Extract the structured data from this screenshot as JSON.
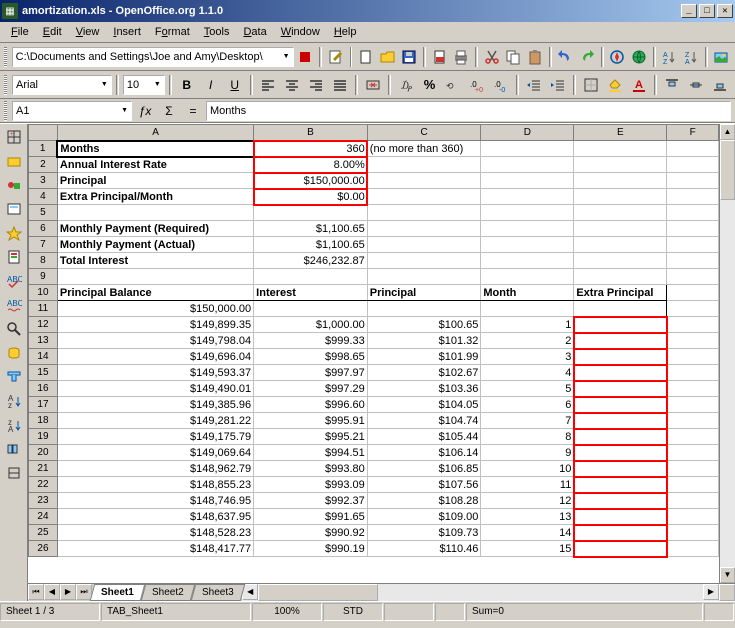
{
  "title": "amortization.xls - OpenOffice.org 1.1.0",
  "menu": [
    "File",
    "Edit",
    "View",
    "Insert",
    "Format",
    "Tools",
    "Data",
    "Window",
    "Help"
  ],
  "path": "C:\\Documents and Settings\\Joe and Amy\\Desktop\\",
  "font": {
    "name": "Arial",
    "size": "10"
  },
  "cell_ref": "A1",
  "formula_content": "Months",
  "columns": [
    "A",
    "B",
    "C",
    "D",
    "E",
    "F"
  ],
  "col_headers_row": {
    "A": "Principal Balance",
    "B": "Interest",
    "C": "Principal",
    "D": "Month",
    "E": "Extra Principal"
  },
  "top_rows": [
    {
      "r": 1,
      "A": "Months",
      "B": "360",
      "C": "(no more than 360)",
      "Bred": true,
      "Abold": true,
      "Bar": true,
      "Asel": true
    },
    {
      "r": 2,
      "A": "Annual Interest Rate",
      "B": "8.00%",
      "Bred": true,
      "Abold": true,
      "Bar": true
    },
    {
      "r": 3,
      "A": "Principal",
      "B": "$150,000.00",
      "Bred": true,
      "Abold": true,
      "Bar": true
    },
    {
      "r": 4,
      "A": "Extra Principal/Month",
      "B": "$0.00",
      "Bred": true,
      "Abold": true,
      "Bar": true
    },
    {
      "r": 5
    },
    {
      "r": 6,
      "A": "Monthly Payment (Required)",
      "B": "$1,100.65",
      "Abold": true,
      "Bar": true
    },
    {
      "r": 7,
      "A": "Monthly Payment (Actual)",
      "B": "$1,100.65",
      "Abold": true,
      "Bar": true
    },
    {
      "r": 8,
      "A": "Total Interest",
      "B": "$246,232.87",
      "Abold": true,
      "Bar": true
    },
    {
      "r": 9
    }
  ],
  "data_rows": [
    {
      "r": 11,
      "A": "$150,000.00",
      "B": "",
      "C": "",
      "D": "",
      "Ered": false
    },
    {
      "r": 12,
      "A": "$149,899.35",
      "B": "$1,000.00",
      "C": "$100.65",
      "D": "1",
      "Ered": true
    },
    {
      "r": 13,
      "A": "$149,798.04",
      "B": "$999.33",
      "C": "$101.32",
      "D": "2",
      "Ered": true
    },
    {
      "r": 14,
      "A": "$149,696.04",
      "B": "$998.65",
      "C": "$101.99",
      "D": "3",
      "Ered": true
    },
    {
      "r": 15,
      "A": "$149,593.37",
      "B": "$997.97",
      "C": "$102.67",
      "D": "4",
      "Ered": true
    },
    {
      "r": 16,
      "A": "$149,490.01",
      "B": "$997.29",
      "C": "$103.36",
      "D": "5",
      "Ered": true
    },
    {
      "r": 17,
      "A": "$149,385.96",
      "B": "$996.60",
      "C": "$104.05",
      "D": "6",
      "Ered": true
    },
    {
      "r": 18,
      "A": "$149,281.22",
      "B": "$995.91",
      "C": "$104.74",
      "D": "7",
      "Ered": true
    },
    {
      "r": 19,
      "A": "$149,175.79",
      "B": "$995.21",
      "C": "$105.44",
      "D": "8",
      "Ered": true
    },
    {
      "r": 20,
      "A": "$149,069.64",
      "B": "$994.51",
      "C": "$106.14",
      "D": "9",
      "Ered": true
    },
    {
      "r": 21,
      "A": "$148,962.79",
      "B": "$993.80",
      "C": "$106.85",
      "D": "10",
      "Ered": true
    },
    {
      "r": 22,
      "A": "$148,855.23",
      "B": "$993.09",
      "C": "$107.56",
      "D": "11",
      "Ered": true
    },
    {
      "r": 23,
      "A": "$148,746.95",
      "B": "$992.37",
      "C": "$108.28",
      "D": "12",
      "Ered": true
    },
    {
      "r": 24,
      "A": "$148,637.95",
      "B": "$991.65",
      "C": "$109.00",
      "D": "13",
      "Ered": true
    },
    {
      "r": 25,
      "A": "$148,528.23",
      "B": "$990.92",
      "C": "$109.73",
      "D": "14",
      "Ered": true
    },
    {
      "r": 26,
      "A": "$148,417.77",
      "B": "$990.19",
      "C": "$110.46",
      "D": "15",
      "Ered": true
    }
  ],
  "sheet_tabs": [
    "Sheet1",
    "Sheet2",
    "Sheet3"
  ],
  "status": {
    "sheet_count": "Sheet 1 / 3",
    "tab": "TAB_Sheet1",
    "zoom": "100%",
    "mode": "STD",
    "sum": "Sum=0"
  },
  "icons": {
    "min": "_",
    "max": "□",
    "close": "✕",
    "fx": "ƒx",
    "sum": "Σ",
    "eq": "=",
    "bold": "B",
    "italic": "I",
    "underline": "U",
    "left": "≡",
    "center": "≡",
    "right": "≡",
    "justify": "≡"
  }
}
